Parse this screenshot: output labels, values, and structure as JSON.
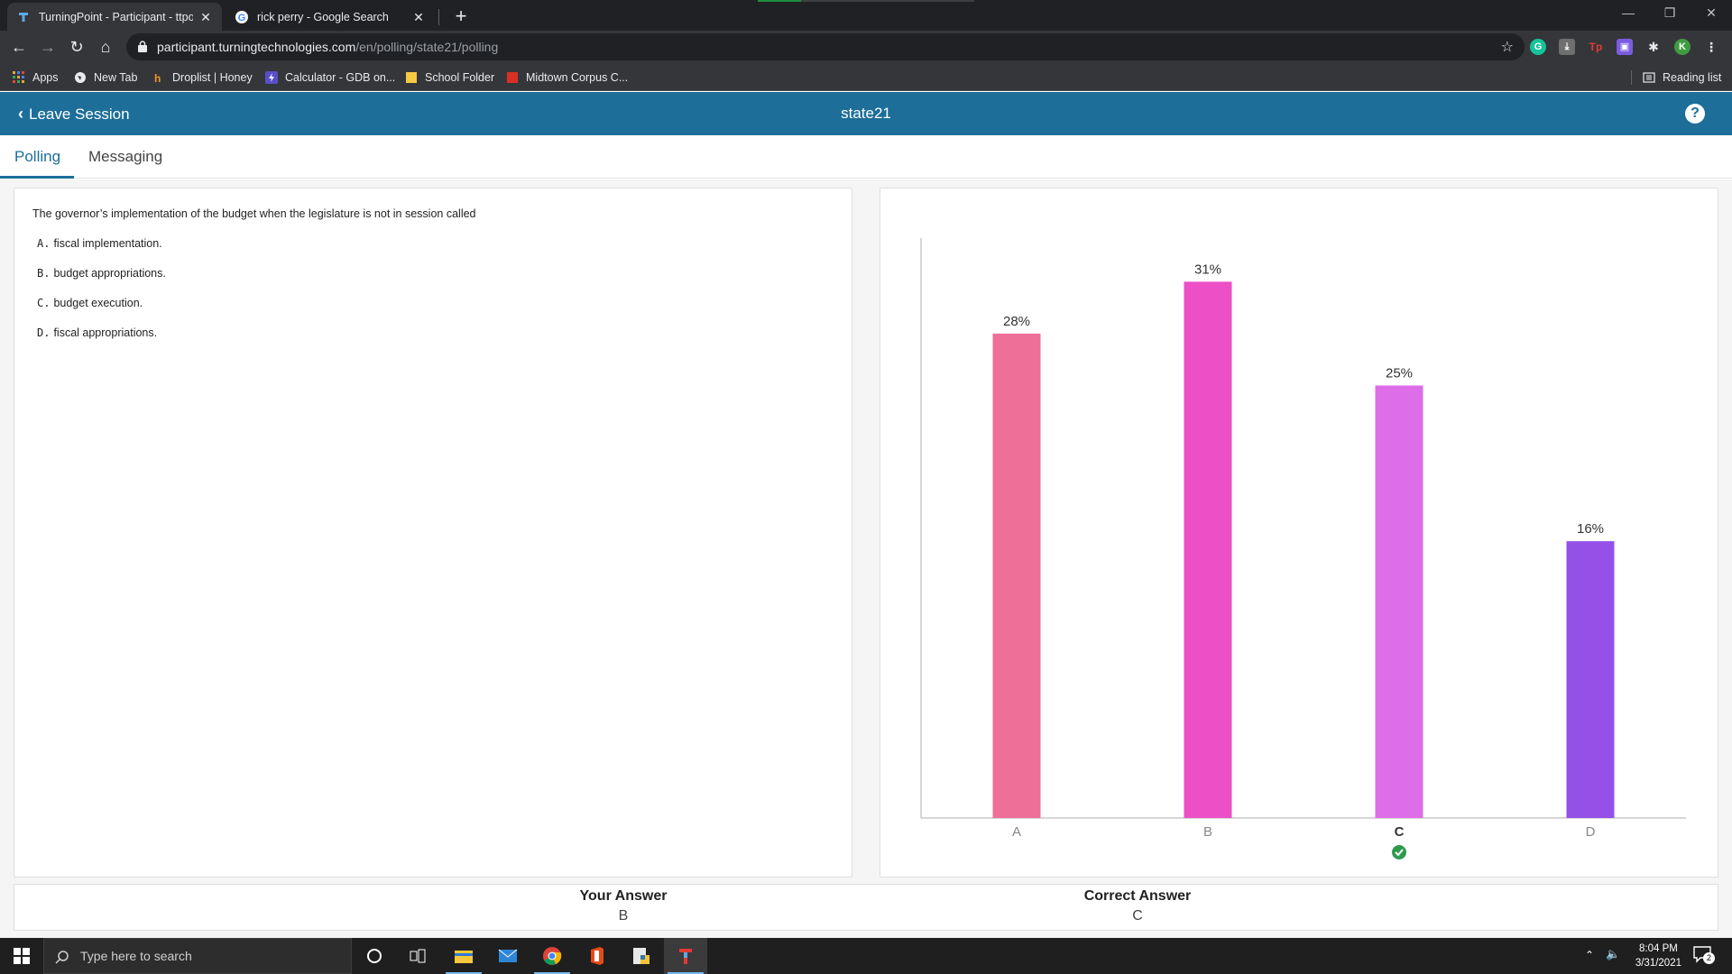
{
  "browser": {
    "tabs": [
      {
        "title": "TurningPoint - Participant - ttpoll",
        "active": true
      },
      {
        "title": "rick perry - Google Search",
        "active": false
      }
    ],
    "url_host": "participant.turningtechnologies.com",
    "url_path": "/en/polling/state21/polling",
    "extension_avatar": "K",
    "bookmarks": [
      {
        "label": "Apps",
        "icon": "apps-grid-icon"
      },
      {
        "label": "New Tab",
        "icon": "globe-icon"
      },
      {
        "label": "Droplist | Honey",
        "icon": "honey-icon"
      },
      {
        "label": "Calculator - GDB on...",
        "icon": "bolt-icon"
      },
      {
        "label": "School Folder",
        "icon": "folder-icon"
      },
      {
        "label": "Midtown Corpus C...",
        "icon": "red-square-icon"
      }
    ],
    "reading_list": "Reading list"
  },
  "app": {
    "leave_label": "Leave Session",
    "session": "state21",
    "tabs": [
      "Polling",
      "Messaging"
    ],
    "active_tab": "Polling"
  },
  "question": {
    "text": "The governor’s implementation of the budget when the legislature is not in session called",
    "choices": [
      {
        "letter": "A.",
        "text": "fiscal implementation."
      },
      {
        "letter": "B.",
        "text": "budget appropriations."
      },
      {
        "letter": "C.",
        "text": "budget execution."
      },
      {
        "letter": "D.",
        "text": "fiscal appropriations."
      }
    ]
  },
  "chart_data": {
    "type": "bar",
    "categories": [
      "A",
      "B",
      "C",
      "D"
    ],
    "values": [
      28,
      31,
      25,
      16
    ],
    "value_labels": [
      "28%",
      "31%",
      "25%",
      "16%"
    ],
    "colors": [
      "#ee6f98",
      "#ec4fc6",
      "#dd6de8",
      "#9550e8"
    ],
    "correct_category": "C",
    "ylim": [
      0,
      33
    ],
    "grid": false
  },
  "result": {
    "your_answer_label": "Your Answer",
    "your_answer": "B",
    "correct_answer_label": "Correct Answer",
    "correct_answer": "C"
  },
  "taskbar": {
    "search_placeholder": "Type here to search",
    "time": "8:04 PM",
    "date": "3/31/2021",
    "notification_count": "2"
  }
}
